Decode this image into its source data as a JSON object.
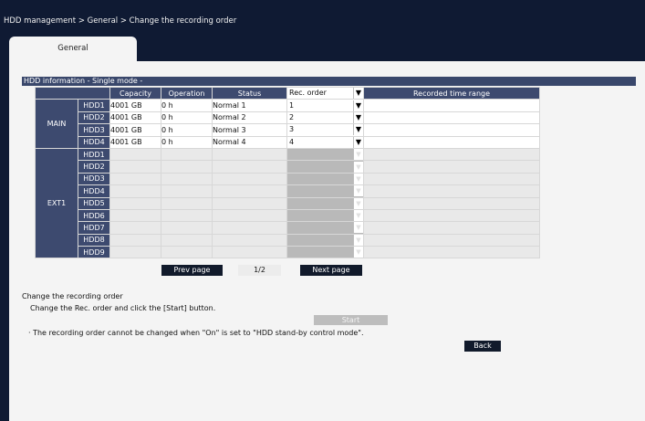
{
  "breadcrumb": "HDD management > General > Change the recording order",
  "tabs": [
    {
      "label": "General"
    }
  ],
  "section_title": "HDD information - Single mode -",
  "table": {
    "headers": [
      "Capacity",
      "Operation",
      "Status",
      "Rec. order",
      "Recorded time range"
    ],
    "main_group": "MAIN",
    "ext_group": "EXT1",
    "main_rows": [
      {
        "hdd": "HDD1",
        "capacity": "4001 GB",
        "operation": "0 h",
        "status": "Normal 1",
        "rec_order": "1"
      },
      {
        "hdd": "HDD2",
        "capacity": "4001 GB",
        "operation": "0 h",
        "status": "Normal 2",
        "rec_order": "2"
      },
      {
        "hdd": "HDD3",
        "capacity": "4001 GB",
        "operation": "0 h",
        "status": "Normal 3",
        "rec_order": "3"
      },
      {
        "hdd": "HDD4",
        "capacity": "4001 GB",
        "operation": "0 h",
        "status": "Normal 4",
        "rec_order": "4"
      }
    ],
    "ext_rows": [
      "HDD1",
      "HDD2",
      "HDD3",
      "HDD4",
      "HDD5",
      "HDD6",
      "HDD7",
      "HDD8",
      "HDD9"
    ]
  },
  "pagination": {
    "prev": "Prev page",
    "page": "1/2",
    "next": "Next page"
  },
  "change_order": {
    "title": "Change the recording order",
    "instruction": "Change the Rec. order and click the [Start] button.",
    "start_label": "Start",
    "note": "· The recording order cannot be changed when \"On\" is set to \"HDD stand-by control mode\"."
  },
  "back_label": "Back",
  "icons": {
    "dropdown": "triangle-down-icon"
  },
  "colors": {
    "frame": "#0f1a33",
    "header": "#3d4a6f",
    "button": "#111a2b"
  }
}
